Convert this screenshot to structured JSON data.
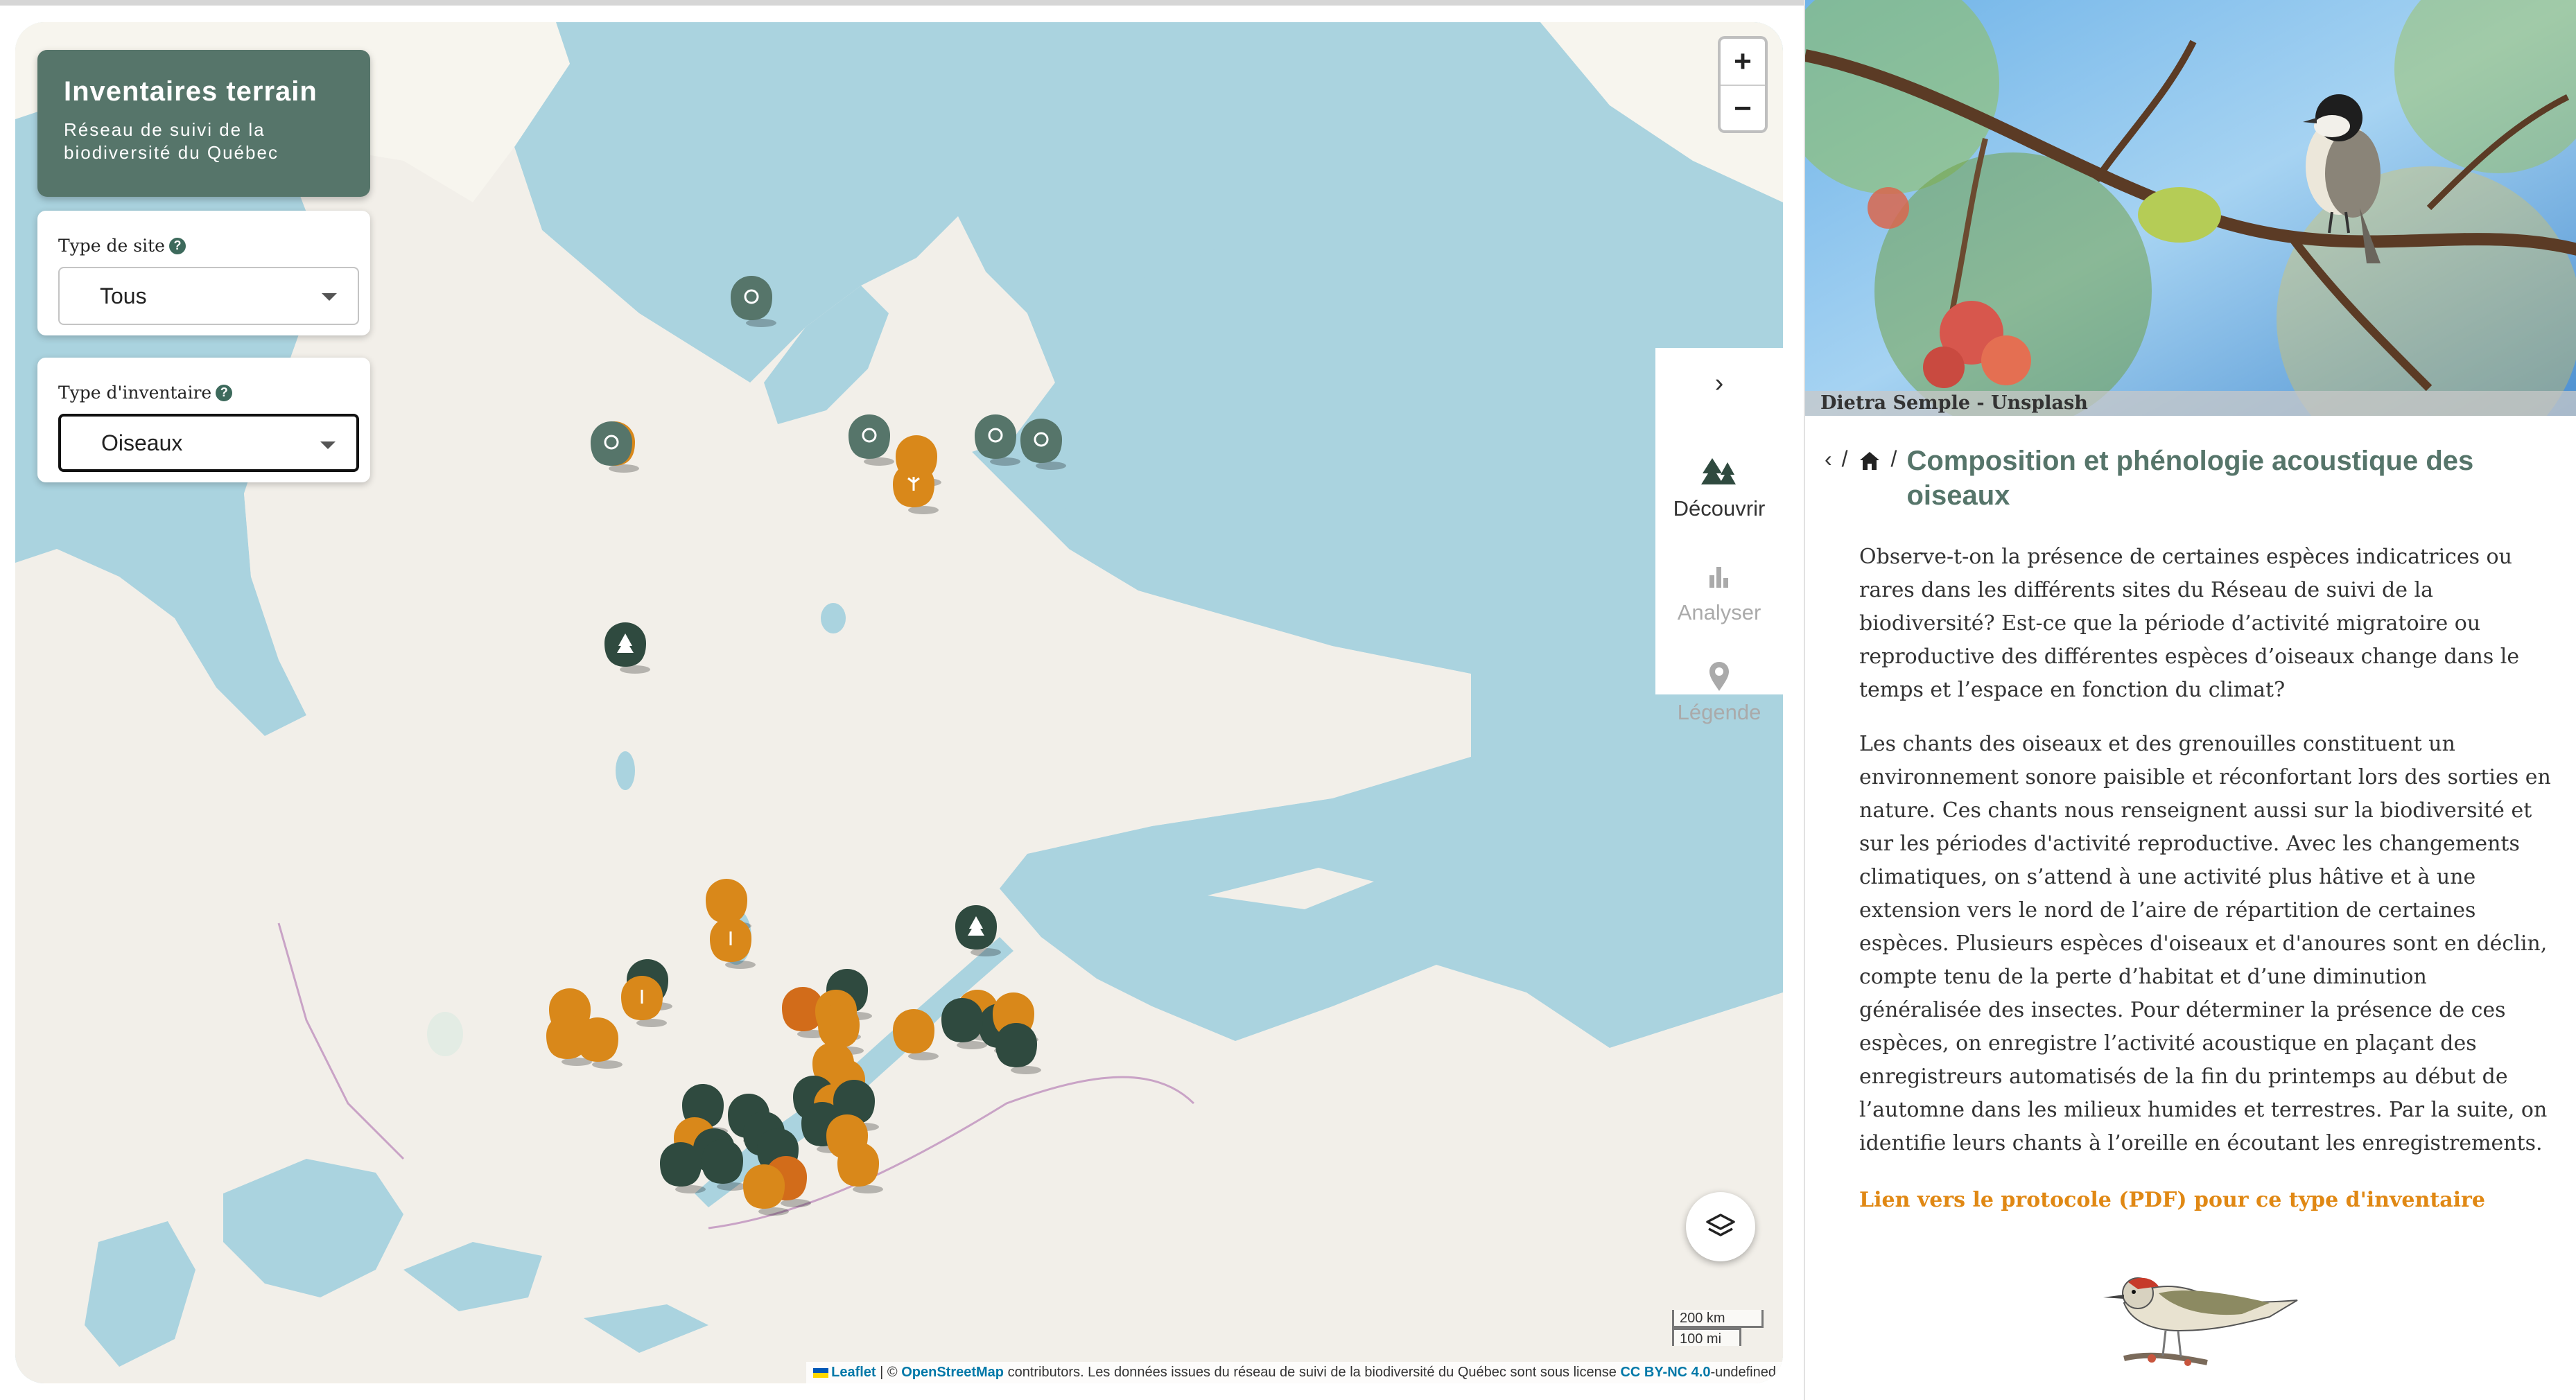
{
  "map": {
    "title": "Inventaires terrain",
    "subtitle": "Réseau de suivi de la biodiversité du Québec",
    "filters": [
      {
        "label": "Type de site",
        "value": "Tous"
      },
      {
        "label": "Type d'inventaire",
        "value": "Oiseaux"
      }
    ],
    "zoom": {
      "in": "+",
      "out": "−"
    },
    "tools": {
      "collapse_icon": "chevron-right-icon",
      "items": [
        {
          "label": "Découvrir",
          "icon": "trees-icon",
          "state": "active"
        },
        {
          "label": "Analyser",
          "icon": "bar-chart-icon",
          "state": "disabled"
        },
        {
          "label": "Légende",
          "icon": "map-pin-icon",
          "state": "disabled"
        }
      ]
    },
    "layers_icon": "layers-icon",
    "scale": {
      "km": "200 km",
      "mi": "100 mi"
    },
    "attribution": {
      "leaflet": "Leaflet",
      "osm_prefix": "| © ",
      "osm": "OpenStreetMap",
      "text": " contributors. Les données issues du réseau de suivi de la biodiversité du Québec sont sous license ",
      "license": "CC BY-NC 4.0",
      "suffix": "-undefined"
    },
    "colors": {
      "water": "#aad3df",
      "land": "#f2efe9",
      "north_land": "#f7f5ee",
      "marker_green": "#56756a",
      "marker_dark": "#2f4a3f",
      "marker_orange": "#d9881a"
    }
  },
  "panel": {
    "photo_credit": "Dietra Semple - Unsplash",
    "breadcrumb": {
      "back": "‹",
      "sep": "/",
      "home_icon": "home-icon"
    },
    "title": "Composition et phénologie acoustique des oiseaux",
    "paragraphs": [
      "Observe-t-on la présence de certaines espèces indicatrices ou rares dans les différents sites du Réseau de suivi de la biodiversité? Est-ce que la période d’activité migratoire ou reproductive des différentes espèces d’oiseaux change dans le temps et l’espace en fonction du climat?",
      "Les chants des oiseaux et des grenouilles constituent un environnement sonore paisible et réconfortant lors des sorties en nature. Ces chants nous renseignent aussi sur la biodiversité et sur les périodes d'activité reproductive. Avec les changements climatiques, on s’attend à une activité plus hâtive et à une extension vers le nord de l’aire de répartition de certaines espèces. Plusieurs espèces d'oiseaux et d'anoures sont en déclin, compte tenu de la perte d’habitat et d’une diminution généralisée des insectes. Pour déterminer la présence de ces espèces, on enregistre l’activité acoustique en plaçant des enregistreurs automatisés de la fin du printemps au début de l’automne dans les milieux humides et terrestres. Par la suite, on identifie leurs chants à l’oreille en écoutant les enregistrements."
    ],
    "protocol_link": "Lien vers le protocole (PDF) pour ce type d'inventaire",
    "illustration": "bird-illustration"
  }
}
